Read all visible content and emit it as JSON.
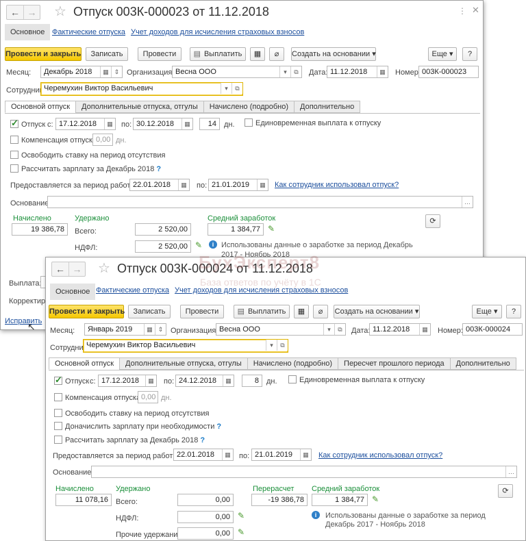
{
  "window1": {
    "title": "Отпуск 003К-000023 от 11.12.2018",
    "nav": {
      "main": "Основное",
      "link1": "Фактические отпуска",
      "link2": "Учет доходов для исчисления страховых взносов"
    },
    "toolbar": {
      "post_close": "Провести и закрыть",
      "save": "Записать",
      "post": "Провести",
      "pay": "Выплатить",
      "create_basis": "Создать на основании",
      "more": "Еще",
      "help": "?"
    },
    "fields": {
      "month_label": "Месяц:",
      "month_value": "Декабрь 2018",
      "org_label": "Организация:",
      "org_value": "Весна ООО",
      "date_label": "Дата:",
      "date_value": "11.12.2018",
      "number_label": "Номер:",
      "number_value": "003К-000023",
      "employee_label": "Сотрудник:",
      "employee_value": "Черемухин Виктор Васильевич"
    },
    "tabs": [
      "Основной отпуск",
      "Дополнительные отпуска, отгулы",
      "Начислено (подробно)",
      "Дополнительно"
    ],
    "vacation": {
      "label": "Отпуск",
      "from_label": "с:",
      "from": "17.12.2018",
      "to_label": "по:",
      "to": "30.12.2018",
      "days": "14",
      "days_label": "дн.",
      "onetime": "Единовременная выплата к отпуску"
    },
    "compensation": {
      "label": "Компенсация отпуска",
      "value": "0,00",
      "unit": "дн."
    },
    "free_rate": "Освободить ставку на период отсутствия",
    "recalc": "Рассчитать зарплату за Декабрь 2018",
    "period": {
      "label": "Предоставляется за период работы с:",
      "from": "22.01.2018",
      "to_label": "по:",
      "to": "21.01.2019",
      "link": "Как сотрудник использовал отпуск?"
    },
    "basis_label": "Основание:",
    "accrued_label": "Начислено",
    "accrued_value": "19 386,78",
    "withheld_label": "Удержано",
    "total_label": "Всего:",
    "total_value": "2 520,00",
    "ndfl_label": "НДФЛ:",
    "ndfl_value": "2 520,00",
    "avg_label": "Средний заработок",
    "avg_value": "1 384,77",
    "info_text": "Использованы данные о заработке за период Декабрь 2017 - Ноябрь 2018",
    "payout_label": "Выплата:",
    "correction_label": "Корректиро",
    "fix_link": "Исправить"
  },
  "window2": {
    "title": "Отпуск 003К-000024 от 11.12.2018",
    "nav": {
      "main": "Основное",
      "link1": "Фактические отпуска",
      "link2": "Учет доходов для исчисления страховых взносов"
    },
    "toolbar": {
      "post_close": "Провести и закрыть",
      "save": "Записать",
      "post": "Провести",
      "pay": "Выплатить",
      "create_basis": "Создать на основании",
      "more": "Еще",
      "help": "?"
    },
    "fields": {
      "month_label": "Месяц:",
      "month_value": "Январь 2019",
      "org_label": "Организация:",
      "org_value": "Весна ООО",
      "date_label": "Дата:",
      "date_value": "11.12.2018",
      "number_label": "Номер:",
      "number_value": "003К-000024",
      "employee_label": "Сотрудник:",
      "employee_value": "Черемухин Виктор Васильевич"
    },
    "tabs": [
      "Основной отпуск",
      "Дополнительные отпуска, отгулы",
      "Начислено (подробно)",
      "Пересчет прошлого периода",
      "Дополнительно"
    ],
    "vacation": {
      "label": "Отпуск",
      "from_label": "с:",
      "from": "17.12.2018",
      "to_label": "по:",
      "to": "24.12.2018",
      "days": "8",
      "days_label": "дн.",
      "onetime": "Единовременная выплата к отпуску"
    },
    "compensation": {
      "label": "Компенсация отпуска",
      "value": "0,00",
      "unit": "дн."
    },
    "free_rate": "Освободить ставку на период отсутствия",
    "additional_accrual": "Доначислить зарплату при необходимости",
    "recalc": "Рассчитать зарплату за Декабрь 2018",
    "period": {
      "label": "Предоставляется за период работы с:",
      "from": "22.01.2018",
      "to_label": "по:",
      "to": "21.01.2019",
      "link": "Как сотрудник использовал отпуск?"
    },
    "basis_label": "Основание:",
    "accrued_label": "Начислено",
    "accrued_value": "11 078,16",
    "withheld_label": "Удержано",
    "total_label": "Всего:",
    "total_value": "0,00",
    "ndfl_label": "НДФЛ:",
    "ndfl_value": "0,00",
    "other_label": "Прочие удержания:",
    "other_value": "0,00",
    "recalc_label": "Перерасчет",
    "recalc_value": "-19 386,78",
    "avg_label": "Средний заработок",
    "avg_value": "1 384,77",
    "info_text_1": "Использованы данные о заработке за период",
    "info_text_2": "Декабрь 2017 - Ноябрь 2018"
  },
  "watermark": {
    "line1": "БухЭксперт8",
    "line2": "База ответов по учёту в 1С"
  }
}
